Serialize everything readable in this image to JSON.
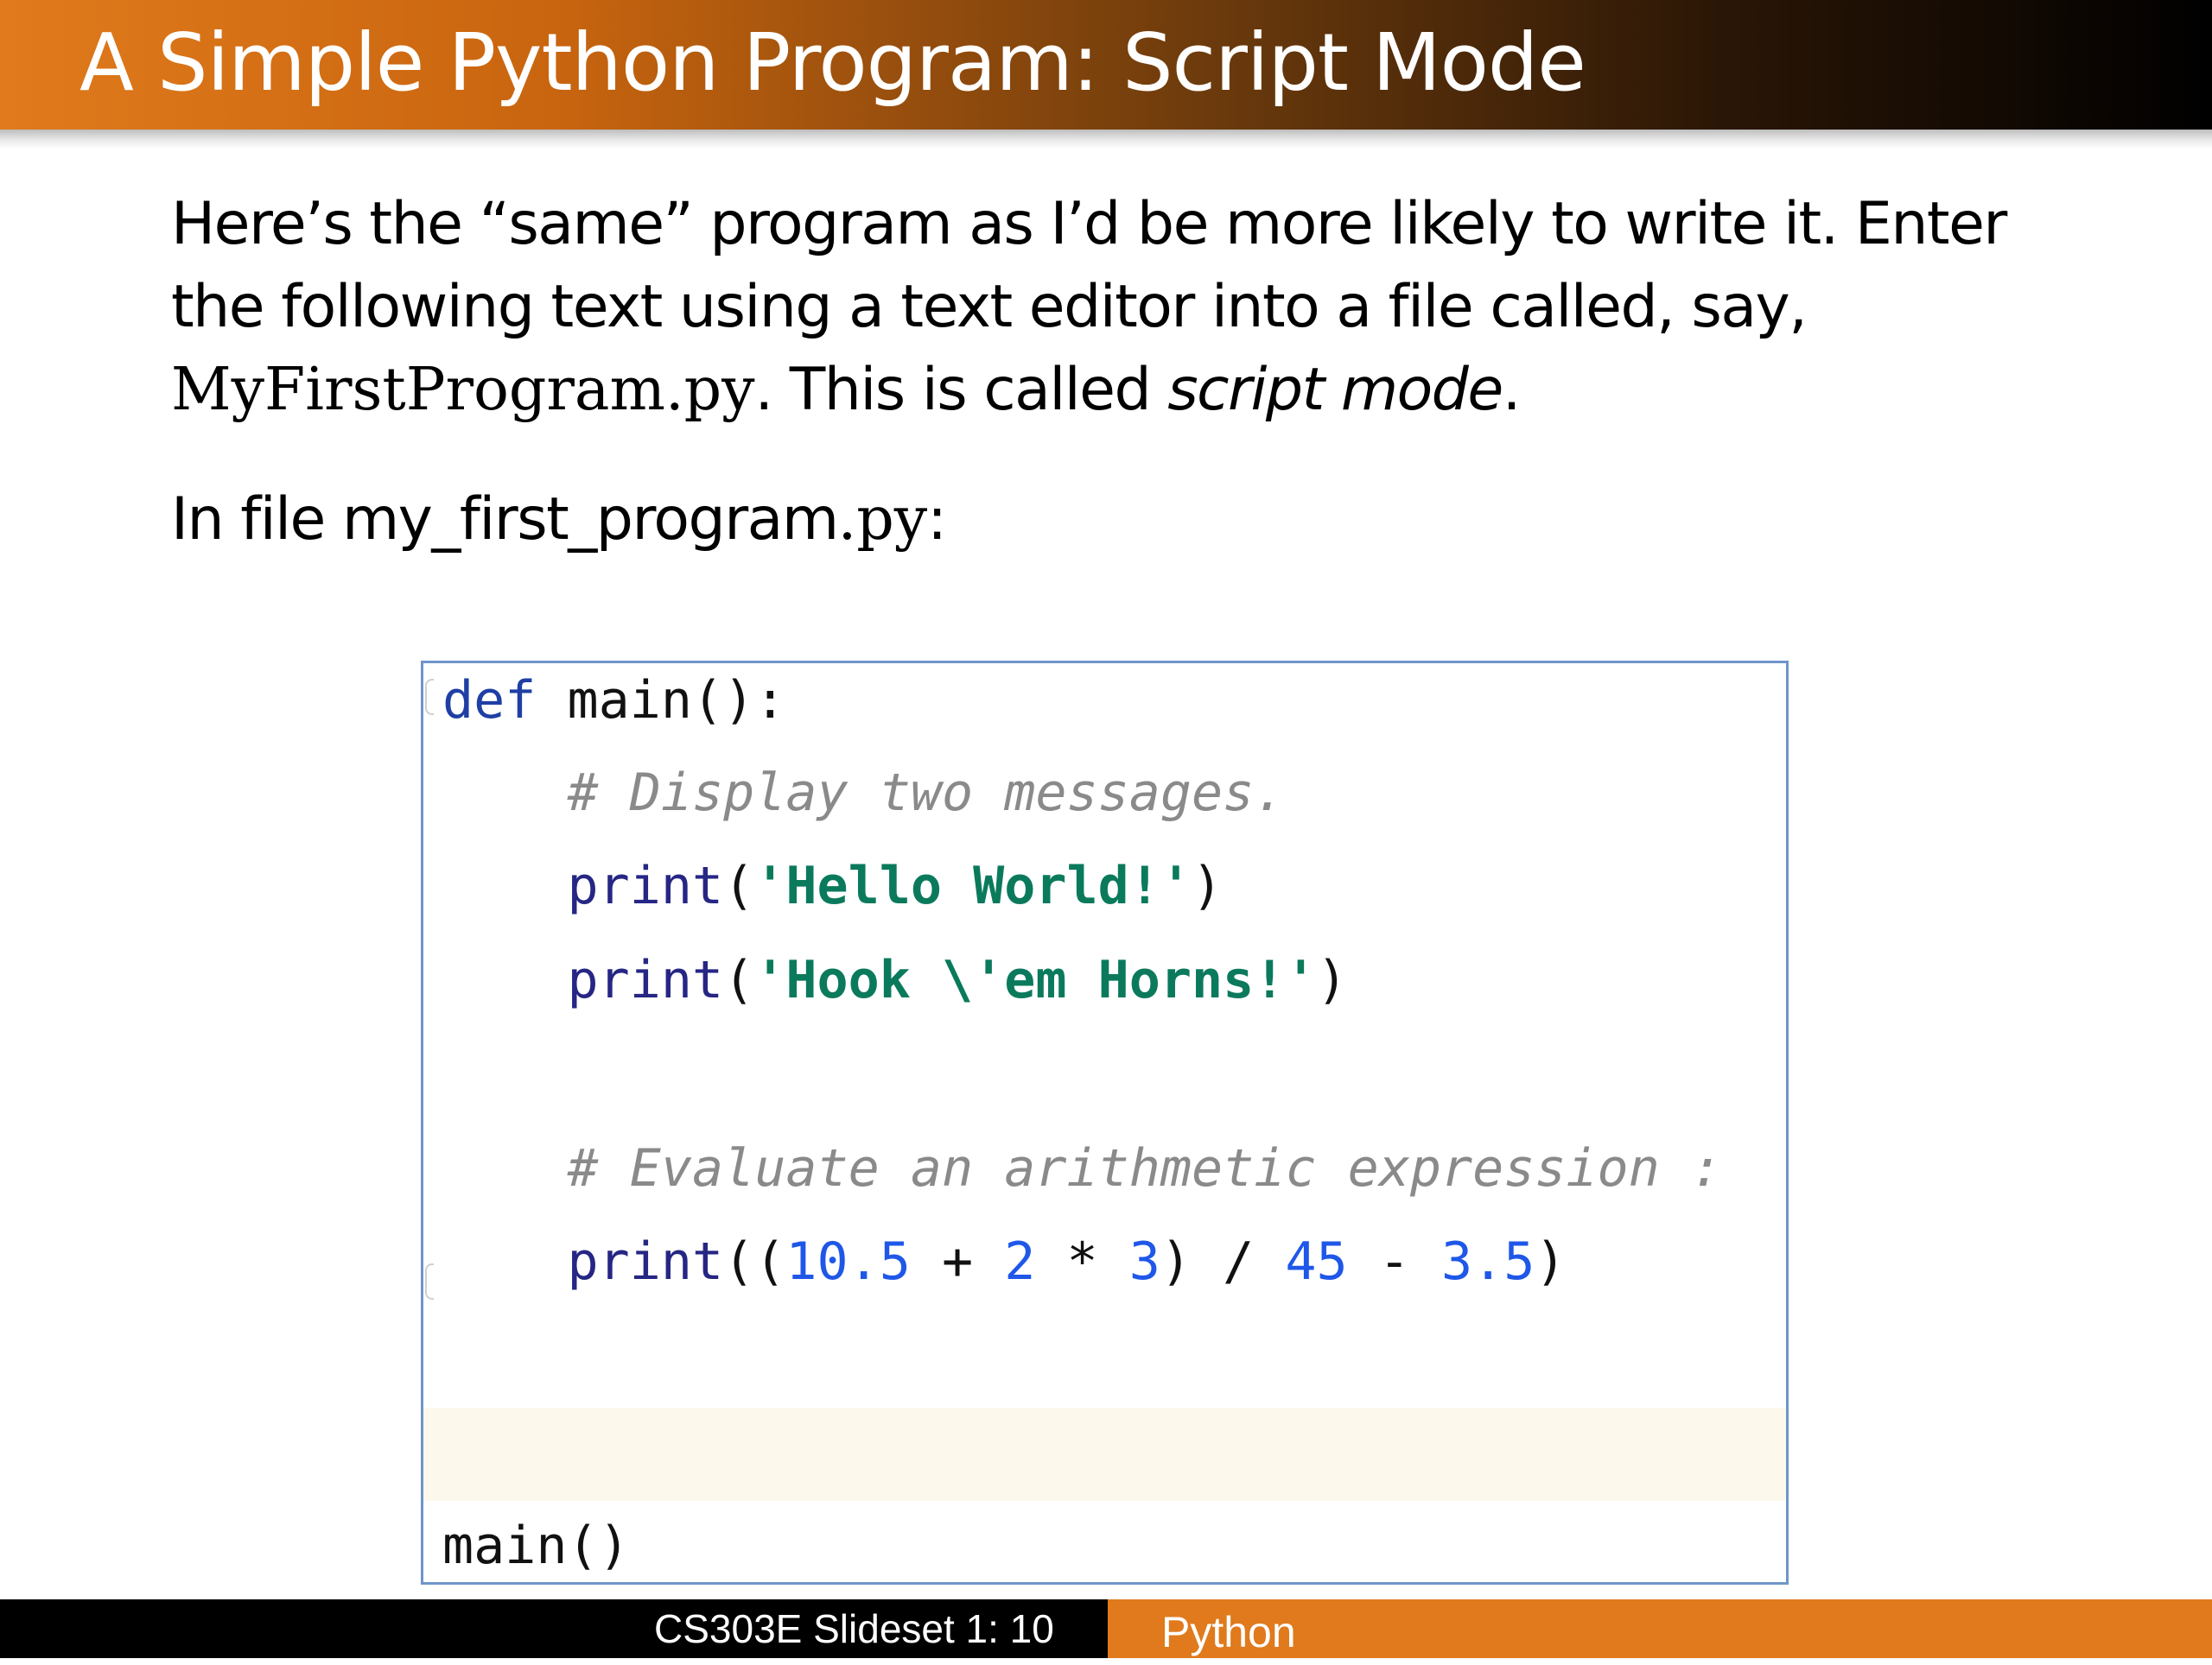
{
  "slide": {
    "title": "A Simple Python Program: Script Mode",
    "paragraph1": {
      "part1": "Here’s the “same” program as I’d be more likely to write it.  Enter the following text using a text editor into a file called, say, ",
      "filename": "MyFirstProgram.py",
      "part2": ".  This is called ",
      "emphasis": "script mode",
      "part3": "."
    },
    "paragraph2": {
      "prefix": "In file my_first_program",
      "ext": ".py",
      "suffix": ":"
    }
  },
  "code": {
    "line1": {
      "kw": "def",
      "rest": " main():"
    },
    "line2": {
      "indent": "    ",
      "comment": "# Display two messages."
    },
    "line3": {
      "indent": "    ",
      "fn": "print",
      "open": "(",
      "str": "'Hello World!'",
      "close": ")"
    },
    "line4": {
      "indent": "    ",
      "fn": "print",
      "open": "(",
      "str": "'Hook \\'em Horns!'",
      "close": ")"
    },
    "line5": {
      "indent": "    ",
      "comment": "# Evaluate an arithmetic expression :"
    },
    "line6": {
      "indent": "    ",
      "fn": "print",
      "open": "((",
      "n1": "10.5",
      "op1": " + ",
      "n2": "2",
      "op2": " * ",
      "n3": "3",
      "mid": ") / ",
      "n4": "45",
      "op3": " - ",
      "n5": "3.5",
      "close": ")"
    },
    "line7": {
      "text": "main()"
    }
  },
  "footer": {
    "slide_label": "CS303E Slideset 1: 10",
    "course": "Python"
  },
  "colors": {
    "title_orange": "#e07a1c",
    "footer_orange": "#e07a1c",
    "keyword_blue": "#1f3fa5",
    "string_green": "#0b7a5c",
    "number_blue": "#1f57e8",
    "comment_gray": "#8a8a8a",
    "code_border": "#6f95c9"
  }
}
